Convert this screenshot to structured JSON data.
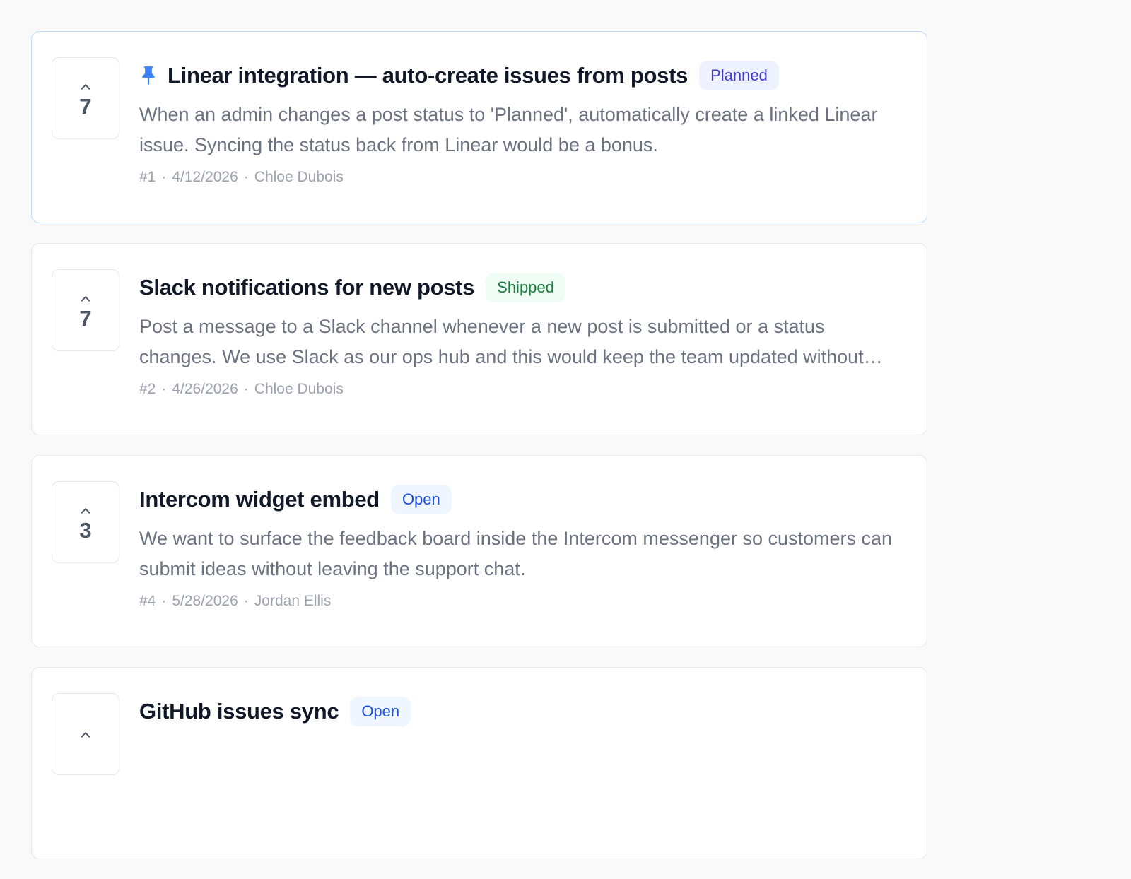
{
  "posts": [
    {
      "pinned": true,
      "votes": "7",
      "title": "Linear integration — auto-create issues from posts",
      "status": "Planned",
      "status_key": "planned",
      "description": "When an admin changes a post status to 'Planned', automatically create a linked Linear issue. Syncing the status back from Linear would be a bonus.",
      "id": "#1",
      "date": "4/12/2026",
      "author": "Chloe Dubois"
    },
    {
      "pinned": false,
      "votes": "7",
      "title": "Slack notifications for new posts",
      "status": "Shipped",
      "status_key": "shipped",
      "description": "Post a message to a Slack channel whenever a new post is submitted or a status changes. We use Slack as our ops hub and this would keep the team updated without checking the...",
      "id": "#2",
      "date": "4/26/2026",
      "author": "Chloe Dubois"
    },
    {
      "pinned": false,
      "votes": "3",
      "title": "Intercom widget embed",
      "status": "Open",
      "status_key": "open",
      "description": "We want to surface the feedback board inside the Intercom messenger so customers can submit ideas without leaving the support chat.",
      "id": "#4",
      "date": "5/28/2026",
      "author": "Jordan Ellis"
    },
    {
      "pinned": false,
      "votes": "",
      "title": "GitHub issues sync",
      "status": "Open",
      "status_key": "open",
      "description": "",
      "id": "",
      "date": "",
      "author": ""
    }
  ],
  "meta_separator": "·",
  "colors": {
    "background": "#f9f9fa",
    "card_border": "#e5e7eb",
    "pinned_border": "#bfdbfe",
    "pin": "#3b82f6",
    "planned": "#4338ca",
    "shipped": "#15803d",
    "open": "#1d4ed8"
  },
  "icons": {
    "pin": "pin-icon",
    "upvote": "chevron-up-icon"
  }
}
